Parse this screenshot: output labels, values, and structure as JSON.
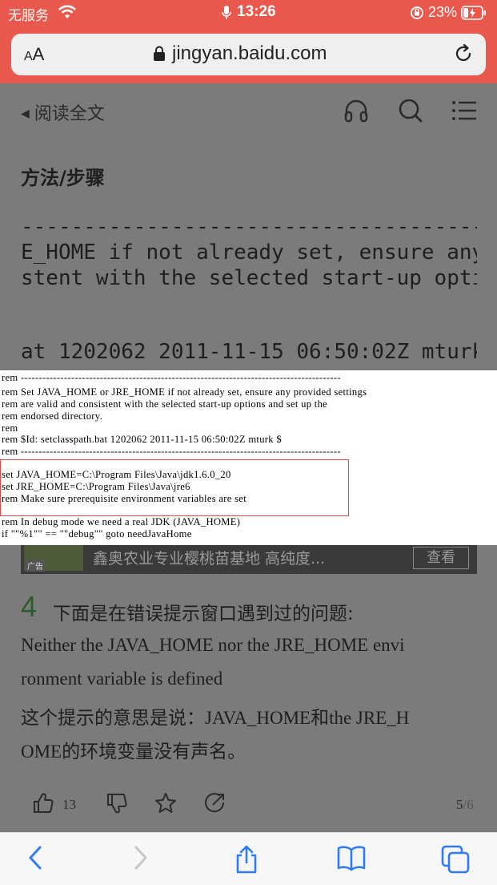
{
  "status_bar": {
    "carrier": "无服务",
    "time": "13:26",
    "battery": "23%"
  },
  "address_bar": {
    "text_size_small": "A",
    "text_size_big": "A",
    "url": "jingyan.baidu.com"
  },
  "article_nav": {
    "back_label": "阅读全文"
  },
  "article": {
    "section_title": "方法/步骤",
    "bg_code_lines": [
      "-----------------------------------------",
      "E_HOME if not already set, ensure any",
      "stent with the selected start-up optio",
      "at 1202062 2011-11-15 06:50:02Z mturk"
    ],
    "ad": {
      "tag": "广告",
      "text": "鑫奥农业专业樱桃苗基地 高纯度...",
      "button": "查看"
    },
    "step": {
      "number": "4",
      "title": "下面是在错误提示窗口遇到过的问题:",
      "lines": [
        " Neither the JAVA_HOME nor the JRE_HOME envi",
        "ronment variable is defined",
        "这个提示的意思是说：JAVA_HOME和the JRE_H",
        "OME的环境变量没有声名。"
      ]
    }
  },
  "code_image": {
    "lines": [
      "rem -----------------------------------------------------------------------------------------",
      "rem Set JAVA_HOME or JRE_HOME if not already set, ensure any provided settings",
      "rem are valid and consistent with the selected start-up options and set up the",
      "rem endorsed directory.",
      "rem",
      "rem $Id: setclasspath.bat 1202062 2011-11-15 06:50:02Z mturk $",
      "rem -----------------------------------------------------------------------------------------",
      "",
      "set JAVA_HOME=C:\\Program Files\\Java\\jdk1.6.0_20",
      "set JRE_HOME=C:\\Program Files\\Java\\jre6",
      "rem Make sure prerequisite environment variables are set",
      "",
      "rem In debug mode we need a real JDK (JAVA_HOME)",
      "if \"\"%1\"\" == \"\"debug\"\" goto needJavaHome"
    ]
  },
  "actions": {
    "like_count": "13",
    "page_current": "5",
    "page_total": "/6"
  },
  "colors": {
    "status_bar_bg": "#e8584c",
    "highlight_box": "#e04848",
    "browser_accent": "#2f7cf6"
  }
}
